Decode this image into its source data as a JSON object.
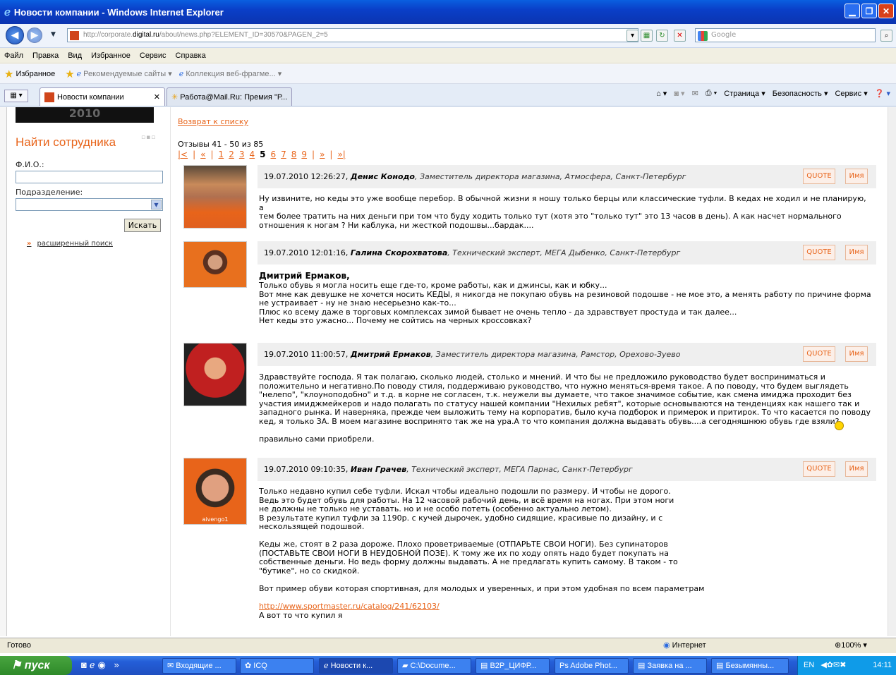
{
  "window": {
    "title": "Новости компании - Windows Internet Explorer"
  },
  "address": {
    "prefix": "http://corporate.",
    "domain": "digital.ru",
    "path": "/about/news.php?ELEMENT_ID=30570&PAGEN_2=5"
  },
  "search": {
    "placeholder": "Google"
  },
  "menu": [
    "Файл",
    "Правка",
    "Вид",
    "Избранное",
    "Сервис",
    "Справка"
  ],
  "favbar": {
    "favorites": "Избранное",
    "recommended": "Рекомендуемые сайты ▾",
    "gallery": "Коллекция веб-фрагме... ▾"
  },
  "tabs": [
    {
      "label": "Новости компании"
    },
    {
      "label": "Работа@Mail.Ru: Премия \"Р..."
    }
  ],
  "commands": {
    "page": "Страница ▾",
    "security": "Безопасность ▾",
    "tools": "Сервис ▾"
  },
  "sidebar": {
    "banner": "2010",
    "find_title": "Найти сотрудника",
    "fio_label": "Ф.И.О.:",
    "dept_label": "Подразделение:",
    "find_button": "Искать",
    "advanced": "расширенный поиск"
  },
  "content": {
    "back_link": "Возврат к списку",
    "count": "Отзывы 41 - 50 из 85",
    "pager": [
      "|<",
      "|",
      "«",
      "|",
      "1",
      "2",
      "3",
      "4",
      "5",
      "6",
      "7",
      "8",
      "9",
      "|",
      "»",
      "|",
      "»|"
    ],
    "quote_label": "QUOTE",
    "name_label": "Имя"
  },
  "posts": [
    {
      "date": "19.07.2010 12:26:27,",
      "author": "Денис Конодо",
      "role": ", Заместитель директора магазина, Атмосфера, Санкт-Петербург",
      "body": "Ну извините, но кеды это уже вообще перебор. В обычной жизни я ношу только берцы или классические туфли. В кедах не ходил и не планирую, а\nтем более тратить на них деньги при том что буду ходить только тут (хотя это \"только тут\" это 13 часов в день). А как насчет нормального\nотношения к ногам ? Ни каблука, ни жесткой подошвы...бардак...."
    },
    {
      "date": "19.07.2010 12:01:16,",
      "author": "Галина Скорохватова",
      "role": ", Технический эксперт, МЕГА Дыбенко, Санкт-Петербург",
      "addressee": "Дмитрий Ермаков,",
      "body": "Только обувь я могла носить еще где-то, кроме работы, как и джинсы, как и юбку...\nВот мне как девушке не хочется носить КЕДЫ, я никогда не покупаю обувь на резиновой подошве - не мое это, а менять работу по причине форма\nне устраивает - ну не знаю несерьезно как-то...\nПлюс ко всему даже в торговых комплексах зимой бывает не очень тепло - да здравствует простуда и так далее...\nНет кеды это ужасно... Почему не сойтись на черных кроссовках?"
    },
    {
      "date": "19.07.2010 11:00:57,",
      "author": "Дмитрий Ермаков",
      "role": ", Заместитель директора магазина, Рамстор, Орехово-Зуево",
      "body": "Здравствуйте господа. Я так полагаю, сколько людей, столько и мнений. И что бы не предложило руководство будет восприниматься и\nположительно и негативно.По поводу стиля, поддерживаю руководство, что нужно меняться-время такое. А по поводу, что будем выглядеть\n\"нелепо\", \"клоуноподобно\" и т.д. в корне не согласен, т.к. неужели вы думаете, что такое значимое событие, как смена имиджа проходит без\nучастия имиджмейкеров и надо полагать по статусу нашей компании \"Нехилых ребят\", которые основываются на тенденциях как нашего так и\nзападного рынка. И наверняка, прежде чем выложить тему на корпоратив, было куча подборок и примерок и притирок. То что касается по поводу\nкед, я только ЗА. В моем магазине воспринято так же на ура.А то что компания должна выдавать обувь....а сегодняшнюю обувь где взяли?",
      "body_end": "правильно сами приобрели."
    },
    {
      "date": "19.07.2010 09:10:35,",
      "author": "Иван Грачев",
      "role": ", Технический эксперт, МЕГА Парнас, Санкт-Петербург",
      "avatar_caption": "aivengo1",
      "body": "Только недавно купил себе туфли. Искал чтобы идеально подошли по размеру. И чтобы не дорого.\nВедь это будет обувь для работы. На 12 часовой рабочий день, и всё время на ногах. При этом ноги\nне должны не только не уставать. но и не особо потеть (особенно актуально летом).\nВ результате купил туфли за 1190р. с кучей дырочек, удобно сидящие, красивые по дизайну, и с\nнескользящей подошвой.\n\nКеды же, стоят в 2 раза дороже. Плохо проветриваемые (ОТПАРЬТЕ СВОИ НОГИ). Без супинаторов\n(ПОСТАВЬТЕ СВОИ НОГИ В НЕУДОБНОЙ ПОЗЕ). К тому же их по ходу опять надо будет покупать на\nсобственные деньги. Но ведь форму должны выдавать. А не предлагать купить самому. В таком - то\n\"бутике\", но со скидкой.\n\nВот пример обуви которая спортивная, для молодых и уверенных, и при этом удобная по всем параметрам",
      "link": "http://www.sportmaster.ru/catalog/241/62103/",
      "tail": "А вот то что купил я"
    }
  ],
  "status": {
    "left": "Готово",
    "zone": "Интернет",
    "zoom": "100%"
  },
  "taskbar": {
    "start": "пуск",
    "tasks": [
      "Входящие ...",
      "ICQ",
      "Новости к...",
      "C:\\Docume...",
      "B2P_ЦИФР...",
      "Adobe Phot...",
      "Заявка на ...",
      "Безымянны..."
    ],
    "lang": "EN",
    "clock": "14:11"
  }
}
